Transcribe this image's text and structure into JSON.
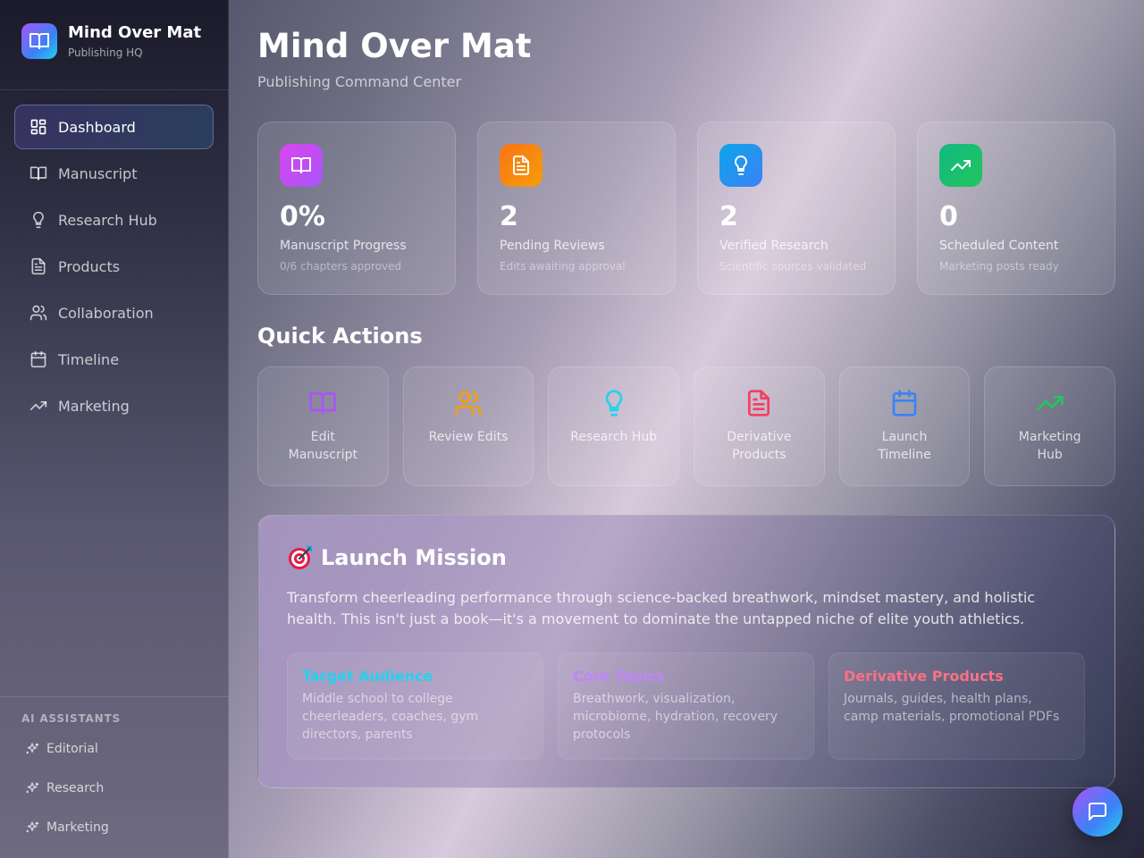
{
  "brand": {
    "title": "Mind Over Mat",
    "subtitle": "Publishing HQ"
  },
  "nav": [
    {
      "label": "Dashboard",
      "icon": "dashboard-icon",
      "active": true
    },
    {
      "label": "Manuscript",
      "icon": "book-icon"
    },
    {
      "label": "Research Hub",
      "icon": "lightbulb-icon"
    },
    {
      "label": "Products",
      "icon": "document-icon"
    },
    {
      "label": "Collaboration",
      "icon": "users-icon"
    },
    {
      "label": "Timeline",
      "icon": "calendar-icon"
    },
    {
      "label": "Marketing",
      "icon": "trending-up-icon"
    }
  ],
  "ai": {
    "title": "AI ASSISTANTS",
    "items": [
      {
        "label": "Editorial",
        "icon": "sparkles-icon"
      },
      {
        "label": "Research",
        "icon": "sparkles-icon"
      },
      {
        "label": "Marketing",
        "icon": "sparkles-icon"
      }
    ]
  },
  "header": {
    "title": "Mind Over Mat",
    "subtitle": "Publishing Command Center"
  },
  "stats": [
    {
      "value": "0%",
      "label": "Manuscript Progress",
      "desc": "0/6 chapters approved",
      "icon": "book-icon",
      "color": "#c026d3"
    },
    {
      "value": "2",
      "label": "Pending Reviews",
      "desc": "Edits awaiting approval",
      "icon": "document-icon",
      "color": "#f97316"
    },
    {
      "value": "2",
      "label": "Verified Research",
      "desc": "Scientific sources validated",
      "icon": "lightbulb-icon",
      "color": "#0ea5e9"
    },
    {
      "value": "0",
      "label": "Scheduled Content",
      "desc": "Marketing posts ready",
      "icon": "trending-up-icon",
      "color": "#10b981"
    }
  ],
  "quick_actions": {
    "title": "Quick Actions",
    "items": [
      {
        "label": "Edit Manuscript",
        "icon": "book-icon",
        "color": "#a855f7"
      },
      {
        "label": "Review Edits",
        "icon": "users-icon",
        "color": "#f59e0b"
      },
      {
        "label": "Research Hub",
        "icon": "lightbulb-icon",
        "color": "#22d3ee"
      },
      {
        "label": "Derivative Products",
        "icon": "document-icon",
        "color": "#f43f5e"
      },
      {
        "label": "Launch Timeline",
        "icon": "calendar-icon",
        "color": "#3b82f6"
      },
      {
        "label": "Marketing Hub",
        "icon": "trending-up-icon",
        "color": "#22c55e"
      }
    ]
  },
  "mission": {
    "title": "Launch Mission",
    "icon": "target-icon",
    "text": "Transform cheerleading performance through science-backed breathwork, mindset mastery, and holistic health. This isn't just a book—it's a movement to dominate the untapped niche of elite youth athletics.",
    "cards": [
      {
        "title": "Target Audience",
        "text": "Middle school to college cheerleaders, coaches, gym directors, parents",
        "color": "#22d3ee"
      },
      {
        "title": "Core Topics",
        "text": "Breathwork, visualization, microbiome, hydration, recovery protocols",
        "color": "#c084fc"
      },
      {
        "title": "Derivative Products",
        "text": "Journals, guides, health plans, camp materials, promotional PDFs",
        "color": "#fb7185"
      }
    ]
  },
  "chat": {
    "icon": "chat-icon"
  }
}
